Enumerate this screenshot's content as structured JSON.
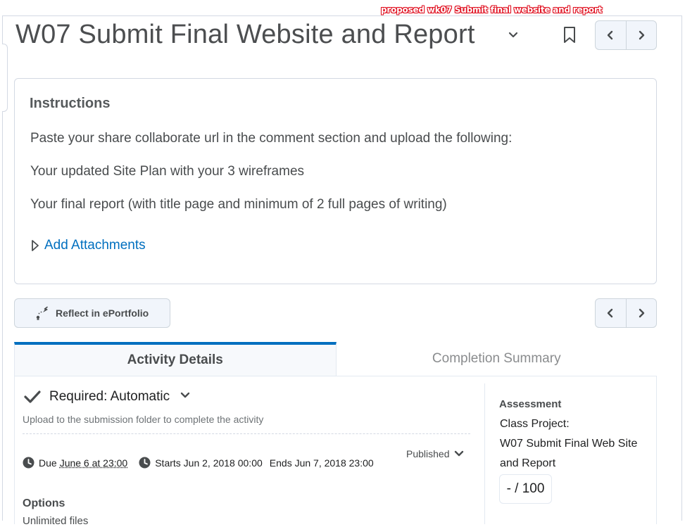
{
  "annotation": "proposed wk07 Submit final website and report",
  "header": {
    "title": "W07 Submit Final Website and Report"
  },
  "instructions": {
    "heading": "Instructions",
    "lines": [
      "Paste your share collaborate url in the comment section and upload the following:",
      "Your updated Site Plan with your 3 wireframes",
      "Your final report (with title page and minimum of 2 full pages of writing)"
    ],
    "add_attachments": "Add Attachments"
  },
  "reflect": {
    "label": "Reflect in ePortfolio"
  },
  "tabs": [
    {
      "label": "Activity Details",
      "active": true
    },
    {
      "label": "Completion Summary",
      "active": false
    }
  ],
  "details": {
    "requirement": "Required: Automatic",
    "requirement_sub": "Upload to the submission folder to complete the activity",
    "published": "Published",
    "due_prefix": "Due",
    "due_date": "June 6 at 23:00",
    "starts": "Starts Jun 2, 2018 00:00",
    "ends": "Ends Jun 7, 2018 23:00",
    "options_heading": "Options",
    "options_clipped": "Unlimited files"
  },
  "assessment": {
    "heading": "Assessment",
    "lines": [
      "Class Project:",
      "W07 Submit Final Web Site",
      "and Report"
    ],
    "score": "- / 100"
  },
  "colors": {
    "accent": "#006fbf",
    "annotation_red": "#e01020",
    "border": "#d3d9e3",
    "button_bg": "#f1f5fb"
  }
}
